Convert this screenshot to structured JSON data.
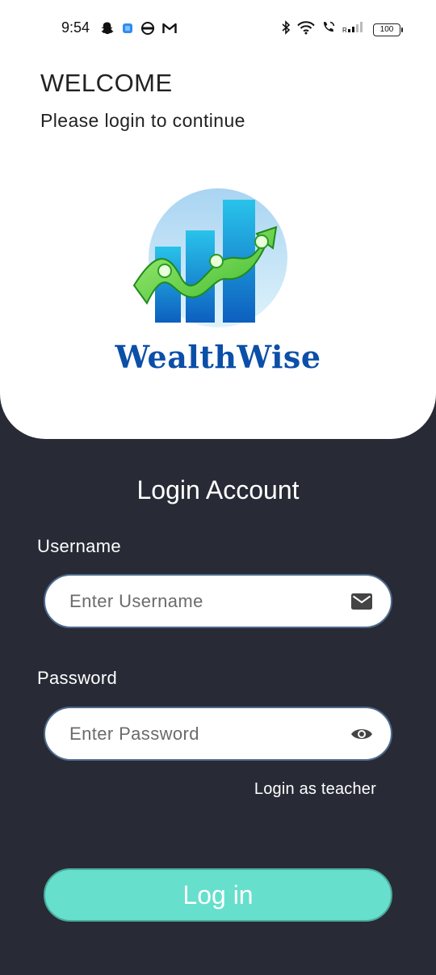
{
  "status_bar": {
    "time": "9:54",
    "battery": "100",
    "left_icons": [
      "snapchat-icon",
      "app-icon",
      "transit-icon",
      "gmail-icon"
    ],
    "right_icons": [
      "bluetooth-icon",
      "wifi-icon",
      "wifi-call-icon",
      "signal-icon",
      "battery-icon"
    ]
  },
  "header": {
    "title": "WELCOME",
    "subtitle": "Please login to continue"
  },
  "logo": {
    "text": "WealthWise",
    "brand_color": "#0b4fa8"
  },
  "form": {
    "title": "Login Account",
    "username": {
      "label": "Username",
      "placeholder": "Enter Username",
      "value": "",
      "icon": "mail-icon"
    },
    "password": {
      "label": "Password",
      "placeholder": "Enter Password",
      "value": "",
      "icon": "eye-icon"
    },
    "teacher_link": "Login as teacher",
    "submit_label": "Log in"
  },
  "colors": {
    "background": "#282a36",
    "card": "#ffffff",
    "button": "#66dfcc",
    "input_border": "#4d6c8c"
  }
}
